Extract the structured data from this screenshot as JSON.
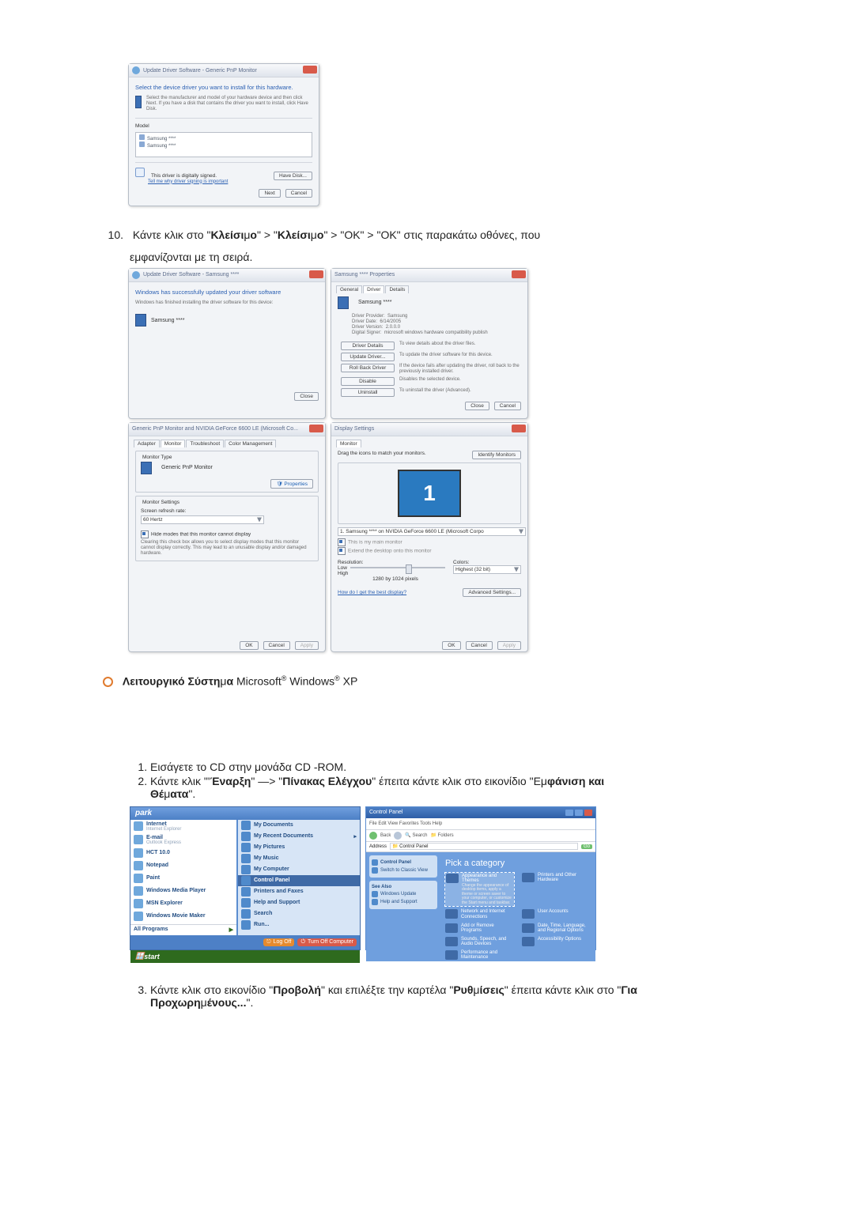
{
  "dlg1": {
    "title": "Update Driver Software - Generic PnP Monitor",
    "heading": "Select the device driver you want to install for this hardware.",
    "sub": "Select the manufacturer and model of your hardware device and then click Next. If you have a disk that contains the driver you want to install, click Have Disk.",
    "model_label": "Model",
    "models": [
      "Samsung ****",
      "Samsung ****"
    ],
    "signed": "This driver is digitally signed.",
    "tell": "Tell me why driver signing is important",
    "have_disk": "Have Disk...",
    "next": "Next",
    "cancel": "Cancel"
  },
  "step10a": "Κάντε κλικ στο \"",
  "step10_close": "Κλείσι",
  "step10_mo": "μ",
  "step10_o": "ο",
  "step10_mid": "\" > \"",
  "step10_ok": "\" > \"OK\" > \"OK\" στις παρακάτω οθόνες, που",
  "step10b": "εμφανίζονται με τη σειρά.",
  "q1": {
    "title": "Update Driver Software - Samsung ****",
    "heading": "Windows has successfully updated your driver software",
    "sub": "Windows has finished installing the driver software for this device:",
    "dev": "Samsung ****",
    "close": "Close"
  },
  "q2": {
    "title": "Samsung **** Properties",
    "tabs": [
      "General",
      "Driver",
      "Details"
    ],
    "dev": "Samsung ****",
    "rows": {
      "provider_l": "Driver Provider:",
      "provider_v": "Samsung",
      "date_l": "Driver Date:",
      "date_v": "6/14/2005",
      "ver_l": "Driver Version:",
      "ver_v": "2.0.0.0",
      "sig_l": "Digital Signer:",
      "sig_v": "microsoft windows hardware compatibility publish"
    },
    "btns": {
      "details": "Driver Details",
      "details_h": "To view details about the driver files.",
      "update": "Update Driver...",
      "update_h": "To update the driver software for this device.",
      "roll": "Roll Back Driver",
      "roll_h": "If the device fails after updating the driver, roll back to the previously installed driver.",
      "disable": "Disable",
      "disable_h": "Disables the selected device.",
      "uninstall": "Uninstall",
      "uninstall_h": "To uninstall the driver (Advanced)."
    },
    "close": "Close",
    "cancel": "Cancel"
  },
  "q3": {
    "title": "Generic PnP Monitor and NVIDIA GeForce 6600 LE (Microsoft Co...",
    "tabs": [
      "Adapter",
      "Monitor",
      "Troubleshoot",
      "Color Management"
    ],
    "type_h": "Monitor Type",
    "type_v": "Generic PnP Monitor",
    "props": "Properties",
    "settings_h": "Monitor Settings",
    "refresh_l": "Screen refresh rate:",
    "refresh_v": "60 Hertz",
    "hide": "Hide modes that this monitor cannot display",
    "hide_sub": "Clearing this check box allows you to select display modes that this monitor cannot display correctly. This may lead to an unusable display and/or damaged hardware.",
    "ok": "OK",
    "cancel": "Cancel",
    "apply": "Apply"
  },
  "q4": {
    "title": "Display Settings",
    "tab": "Monitor",
    "drag": "Drag the icons to match your monitors.",
    "identify": "Identify Monitors",
    "disp_combo": "1. Samsung **** on NVIDIA GeForce 6600 LE (Microsoft Corpo",
    "chk_main": "This is my main monitor",
    "chk_ext": "Extend the desktop onto this monitor",
    "res_l": "Resolution:",
    "low": "Low",
    "high": "High",
    "res_v": "1280 by 1024 pixels",
    "col_l": "Colors:",
    "col_v": "Highest (32 bit)",
    "best": "How do I get the best display?",
    "adv": "Advanced Settings...",
    "ok": "OK",
    "cancel": "Cancel",
    "apply": "Apply"
  },
  "os_line_a": "Λειτουργικό Σύστη",
  "os_line_mu": "μ",
  "os_line_b": "α",
  "os_line_ms": " Microsoft",
  "os_line_win": " Windows",
  "os_line_xp": " XP",
  "reg": "®",
  "sub_steps": {
    "s1": "Εισάγετε το CD στην μονάδα CD -ROM.",
    "s2a": "Κάντε κλικ \"'",
    "s2_start": "Έναρξη",
    "s2b": "\" —> \"",
    "s2_cp": "Πίνακας Ελέγχου",
    "s2c": "\" έπειτα κάντε κλικ στο εικονίδιο \"Ε",
    "s2_appear": "φάνιση και",
    "s2_themes": "Θέ",
    "s2_m": "μ",
    "s2_ata": "ατα",
    "s2_end": "\"."
  },
  "xp_start": {
    "head": "park",
    "left": [
      {
        "t": "Internet",
        "s": "Internet Explorer"
      },
      {
        "t": "E-mail",
        "s": "Outlook Express"
      },
      {
        "t": "HCT 10.0"
      },
      {
        "t": "Notepad"
      },
      {
        "t": "Paint"
      },
      {
        "t": "Windows Media Player"
      },
      {
        "t": "MSN Explorer"
      },
      {
        "t": "Windows Movie Maker"
      }
    ],
    "all": "All Programs",
    "right": [
      "My Documents",
      "My Recent Documents",
      "My Pictures",
      "My Music",
      "My Computer",
      "Control Panel",
      "Printers and Faxes",
      "Help and Support",
      "Search",
      "Run..."
    ],
    "right_hi_idx": 5,
    "logoff": "Log Off",
    "turnoff": "Turn Off Computer",
    "start": "start"
  },
  "xp_cp": {
    "title": "Control Panel",
    "menus": "File   Edit   View   Favorites   Tools   Help",
    "back": "Back",
    "search": "Search",
    "folders": "Folders",
    "addr_l": "Address",
    "addr_v": "Control Panel",
    "go": "Go",
    "left_h1": "Control Panel",
    "left_i1": "Switch to Classic View",
    "left_h2": "See Also",
    "left_i2": "Windows Update",
    "left_i3": "Help and Support",
    "cat_head": "Pick a category",
    "cats": [
      "Appearance and Themes",
      "Printers and Other Hardware",
      "Network and Internet Connections",
      "User Accounts",
      "Add or Remove Programs",
      "Date, Time, Language, and Regional Options",
      "Sounds, Speech, and Audio Devices",
      "Accessibility Options",
      "Performance and Maintenance"
    ],
    "hint": "Change the appearance of desktop items, apply a theme or screen saver to your computer, or customize the Start menu and taskbar."
  },
  "step3_a": "Κάντε κλικ στο εικονίδιο \"",
  "step3_disp": "Προβολή",
  "step3_b": "\" και επιλέξτε την καρτέλα \"",
  "step3_set": "Ρυθ",
  "step3_m": "μ",
  "step3_set2": "ίσεις",
  "step3_c": "\" έπειτα κάντε κλικ στο \"",
  "step3_adv": "Για",
  "step3_adv2": "Προχωρη",
  "step3_adv3": "ένους...",
  "step3_end": "\"."
}
